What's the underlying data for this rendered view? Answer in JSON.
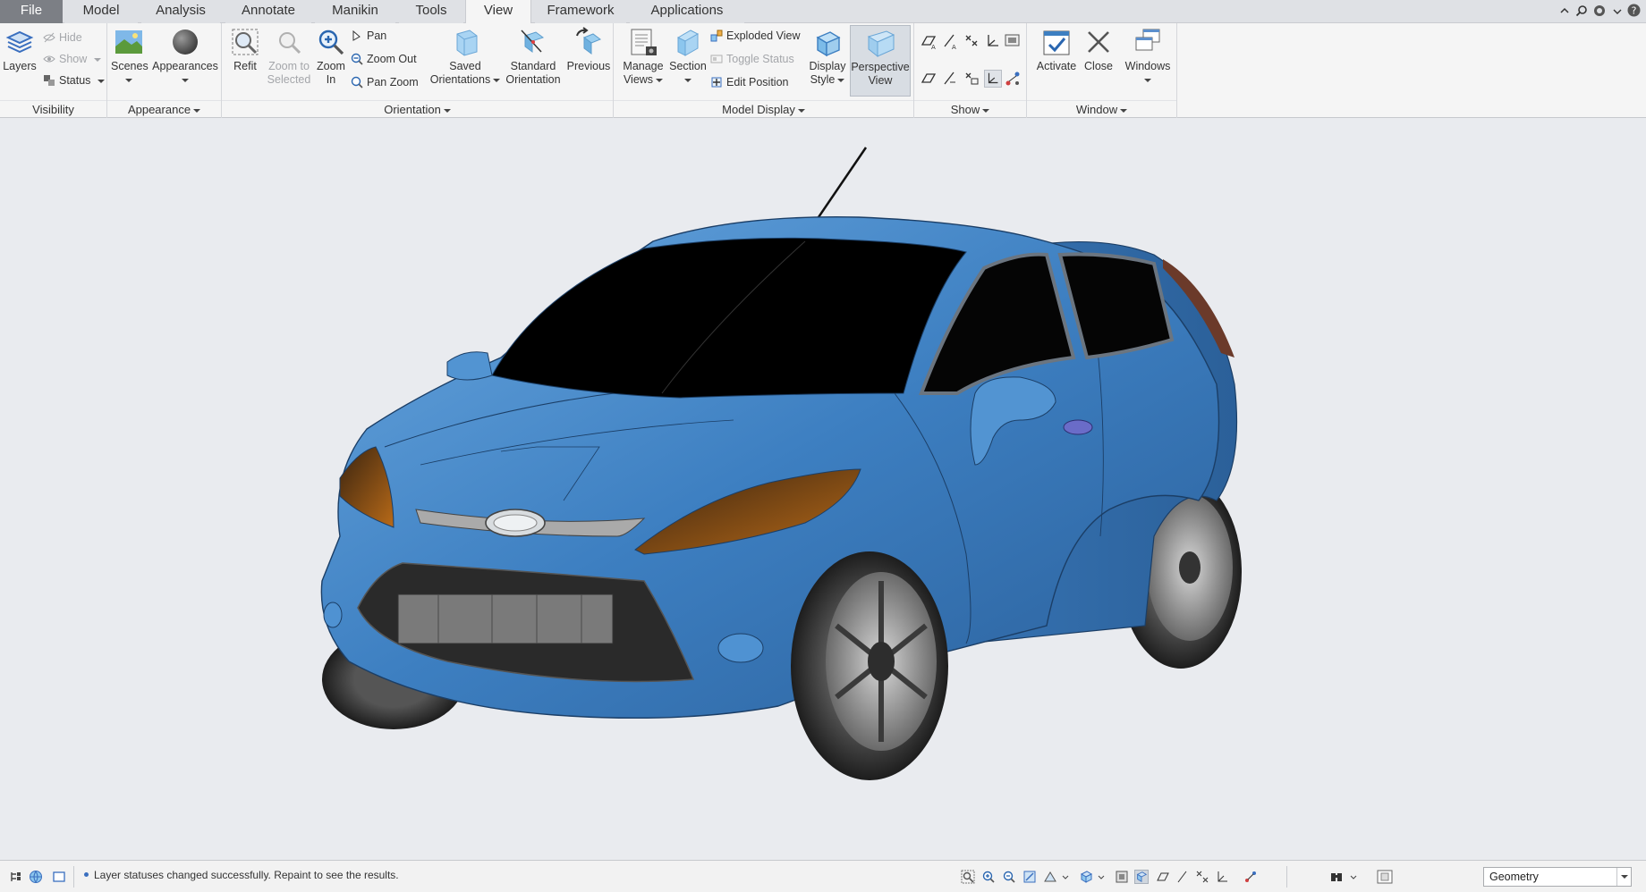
{
  "tabs": [
    {
      "label": "File"
    },
    {
      "label": "Model"
    },
    {
      "label": "Analysis"
    },
    {
      "label": "Annotate"
    },
    {
      "label": "Manikin"
    },
    {
      "label": "Tools"
    },
    {
      "label": "View"
    },
    {
      "label": "Framework"
    },
    {
      "label": "Applications"
    }
  ],
  "active_tab": "View",
  "ribbon": {
    "visibility": {
      "label": "Visibility",
      "layers": "Layers",
      "hide": "Hide",
      "show": "Show",
      "status": "Status"
    },
    "appearance": {
      "label": "Appearance",
      "scenes": "Scenes",
      "appearances": "Appearances"
    },
    "orientation": {
      "label": "Orientation",
      "refit": "Refit",
      "zoom_to_selected_1": "Zoom to",
      "zoom_to_selected_2": "Selected",
      "zoom_in_1": "Zoom",
      "zoom_in_2": "In",
      "pan": "Pan",
      "zoom_out": "Zoom Out",
      "pan_zoom": "Pan Zoom",
      "saved_orientations_1": "Saved",
      "saved_orientations_2": "Orientations",
      "standard_orientation_1": "Standard",
      "standard_orientation_2": "Orientation",
      "previous": "Previous"
    },
    "model_display": {
      "label": "Model Display",
      "manage_views_1": "Manage",
      "manage_views_2": "Views",
      "section": "Section",
      "exploded_view": "Exploded View",
      "toggle_status": "Toggle Status",
      "edit_position": "Edit Position",
      "display_style_1": "Display",
      "display_style_2": "Style",
      "perspective_view_1": "Perspective",
      "perspective_view_2": "View"
    },
    "show": {
      "label": "Show"
    },
    "window": {
      "label": "Window",
      "activate": "Activate",
      "close": "Close",
      "windows": "Windows"
    }
  },
  "status_bar": {
    "message": "Layer statuses changed successfully. Repaint to see the results.",
    "filter_value": "Geometry"
  },
  "colors": {
    "car_body": "#3d7fc1",
    "ribbon_bg": "#f5f5f5",
    "viewport_bg": "#e9ebef",
    "file_tab": "#7c7f85"
  }
}
